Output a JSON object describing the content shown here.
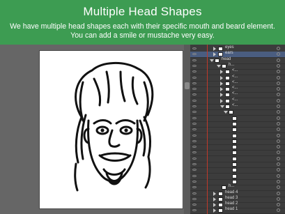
{
  "banner": {
    "title": "Multiple Head Shapes",
    "description": "We have multiple head shapes each with their specific mouth and beard element. You can add a smile or mustache very easy."
  },
  "colors": {
    "banner_bg": "#3d9c52",
    "selected_row": "#4a5d80",
    "guide_line": "#c0392b"
  },
  "icons": {
    "visibility": "eye-icon",
    "expand": "disclosure-triangle-icon",
    "target": "target-circle-icon"
  },
  "layers": [
    {
      "label": "eyes",
      "indent": 1,
      "expander": "closed",
      "thumb": true,
      "selected": false
    },
    {
      "label": "ears",
      "indent": 1,
      "expander": "closed",
      "thumb": true,
      "selected": true
    },
    {
      "label": "head",
      "indent": 0,
      "expander": "open",
      "thumb": true,
      "selected": false
    },
    {
      "label": "h...",
      "indent": 2,
      "expander": "open",
      "thumb": true,
      "selected": false
    },
    {
      "label": "<...",
      "indent": 3,
      "expander": "closed",
      "thumb": true,
      "selected": false
    },
    {
      "label": "<...",
      "indent": 3,
      "expander": "closed",
      "thumb": true,
      "selected": false
    },
    {
      "label": "<...",
      "indent": 3,
      "expander": "closed",
      "thumb": true,
      "selected": false
    },
    {
      "label": "<...",
      "indent": 3,
      "expander": "closed",
      "thumb": true,
      "selected": false
    },
    {
      "label": "<...",
      "indent": 3,
      "expander": "closed",
      "thumb": true,
      "selected": false
    },
    {
      "label": "<...",
      "indent": 3,
      "expander": "closed",
      "thumb": true,
      "selected": false
    },
    {
      "label": "<...",
      "indent": 3,
      "expander": "open",
      "thumb": true,
      "selected": false
    },
    {
      "label": "",
      "indent": 4,
      "expander": "open",
      "thumb": true,
      "selected": false
    },
    {
      "label": "",
      "indent": 5,
      "expander": "none",
      "thumb": true,
      "selected": false
    },
    {
      "label": "",
      "indent": 5,
      "expander": "none",
      "thumb": true,
      "selected": false
    },
    {
      "label": "",
      "indent": 5,
      "expander": "none",
      "thumb": true,
      "selected": false
    },
    {
      "label": "",
      "indent": 5,
      "expander": "none",
      "thumb": true,
      "selected": false
    },
    {
      "label": "",
      "indent": 5,
      "expander": "none",
      "thumb": true,
      "selected": false
    },
    {
      "label": "",
      "indent": 5,
      "expander": "none",
      "thumb": true,
      "selected": false
    },
    {
      "label": "",
      "indent": 5,
      "expander": "none",
      "thumb": true,
      "selected": false
    },
    {
      "label": "",
      "indent": 5,
      "expander": "none",
      "thumb": true,
      "selected": false
    },
    {
      "label": "",
      "indent": 5,
      "expander": "none",
      "thumb": true,
      "selected": false
    },
    {
      "label": "",
      "indent": 5,
      "expander": "none",
      "thumb": true,
      "selected": false
    },
    {
      "label": "",
      "indent": 5,
      "expander": "none",
      "thumb": true,
      "selected": false
    },
    {
      "label": "",
      "indent": 5,
      "expander": "none",
      "thumb": true,
      "selected": false
    },
    {
      "label": "h...",
      "indent": 2,
      "expander": "none",
      "thumb": true,
      "selected": false
    },
    {
      "label": "head 4",
      "indent": 1,
      "expander": "closed",
      "thumb": true,
      "selected": false
    },
    {
      "label": "head 3",
      "indent": 1,
      "expander": "closed",
      "thumb": true,
      "selected": false
    },
    {
      "label": "head 2",
      "indent": 1,
      "expander": "closed",
      "thumb": true,
      "selected": false
    },
    {
      "label": "head 1",
      "indent": 1,
      "expander": "closed",
      "thumb": true,
      "selected": false
    }
  ]
}
